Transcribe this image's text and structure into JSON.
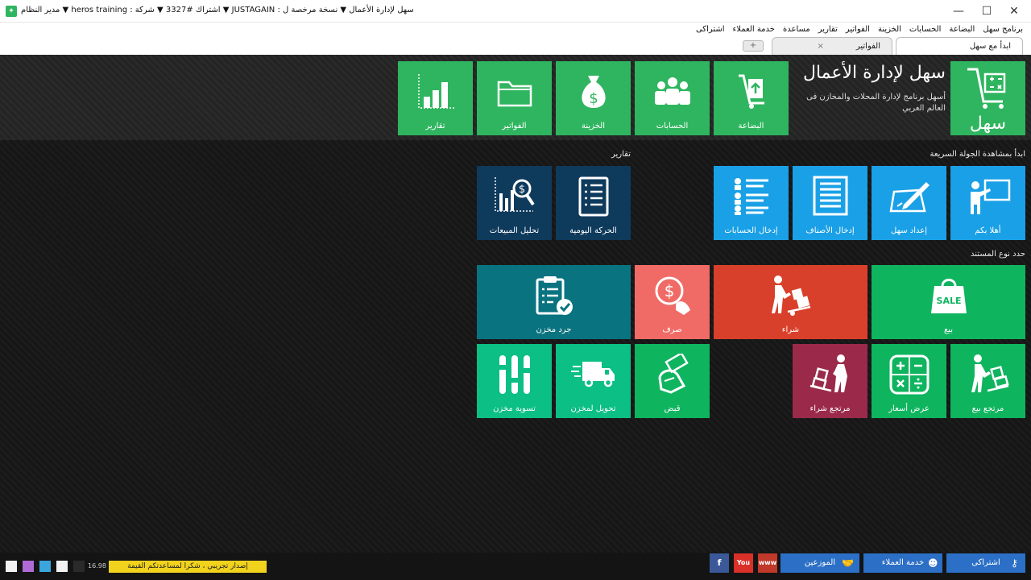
{
  "window": {
    "title": "سهل لإدارة الأعمال  ▼ نسخة مرخصة ل : JUSTAGAIN  ▼ اشتراك #3327  ▼ شركة : heros training  ▼ مدير النظام",
    "minimize": "—",
    "maximize": "☐",
    "close": "✕"
  },
  "menu": [
    "برنامج سهل",
    "البضاعة",
    "الحسابات",
    "الخزينة",
    "الفواتير",
    "تقارير",
    "مساعدة",
    "خدمة العملاء",
    "اشتراكى"
  ],
  "tabs": {
    "start": "ابدأ مع سهل",
    "invoices": "الفواتير",
    "close": "×",
    "add": "+"
  },
  "brand": {
    "logo_text": "سهل",
    "title": "سهل لإدارة الأعمال",
    "subtitle": "أسهل برنامج لإدارة المحلات والمخازن فى العالم العربي"
  },
  "top_tiles": [
    "البضاعة",
    "الحسابات",
    "الخزينة",
    "الفواتير",
    "تقارير"
  ],
  "sections": {
    "tour": "ابدأ بمشاهدة الجولة السريعة",
    "reports": "تقارير",
    "doc_type": "حدد نوع المستند"
  },
  "tour_tiles": [
    "أهلا بكم",
    "إعداد سهل",
    "إدخال الأصناف",
    "إدخال الحسابات"
  ],
  "report_tiles": [
    "الحركة اليومية",
    "تحليل المبيعات"
  ],
  "doc_tiles_row1": [
    "بيع",
    "شراء",
    "صرف",
    "جرد مخزن"
  ],
  "doc_tiles_row1_sale_badge": "SALE",
  "doc_tiles_row2": [
    "مرتجع بيع",
    "عرض أسعار",
    "مرتجع شراء",
    "قبض",
    "تحويل لمخزن",
    "تسوية مخزن"
  ],
  "bottom": {
    "version": "16.98",
    "trial": "إصدار تجريبي ، شكرا لمساعدتكم القيمة",
    "btn_account": "اشتراكى",
    "btn_service": "خدمة العملاء",
    "btn_distributors": "الموزعين",
    "www": "www",
    "youtube": "You",
    "facebook": "f"
  },
  "colors": {
    "green": "#2fb55f",
    "light_blue": "#1aa0e6",
    "navy": "#0e3a5c",
    "teal": "#0a7380",
    "salmon": "#f06b66",
    "red": "#d9402b",
    "emerald": "#0fb45f",
    "mint": "#0cbf84",
    "maroon": "#9b2a4a",
    "button_blue": "#2c6fc6"
  }
}
